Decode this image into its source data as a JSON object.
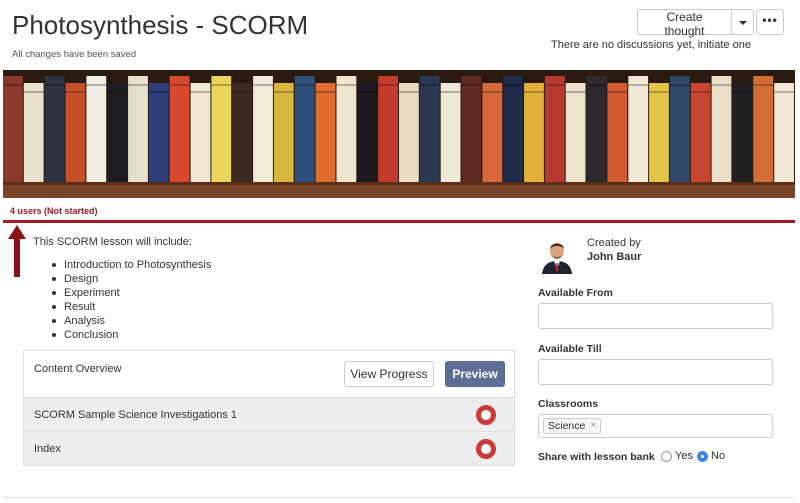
{
  "header": {
    "title": "Photosynthesis - SCORM",
    "save_status": "All changes have been saved",
    "create_thought_label": "Create thought",
    "more_label": "•••",
    "discussion_note": "There are no discussions yet, initiate one"
  },
  "banner": {
    "image": "bookshelf-banner",
    "spines": [
      {
        "color": "#8b3a2a",
        "text": ""
      },
      {
        "color": "#e8e2cf",
        "text": "MIDNIGHT"
      },
      {
        "color": "#2b3440",
        "text": ""
      },
      {
        "color": "#c84f2c",
        "text": ""
      },
      {
        "color": "#f1ede2",
        "text": "THE ELEGANT UNIVERSE"
      },
      {
        "color": "#1f1d24",
        "text": "MOUNTAINS"
      },
      {
        "color": "#e6dfcc",
        "text": ""
      },
      {
        "color": "#2e3e7a",
        "text": "SCIENCE"
      },
      {
        "color": "#d84a2e",
        "text": ""
      },
      {
        "color": "#efe7d1",
        "text": "OLD MAN"
      },
      {
        "color": "#e9d55a",
        "text": ""
      },
      {
        "color": "#3d2b22",
        "text": ""
      },
      {
        "color": "#f2ebda",
        "text": "HOOK BOOKS"
      },
      {
        "color": "#d9b73c",
        "text": "USED"
      },
      {
        "color": "#2d4f7a",
        "text": ""
      },
      {
        "color": "#e26b2f",
        "text": "THE MYSTERY"
      },
      {
        "color": "#efe5cf",
        "text": ""
      },
      {
        "color": "#1d1a1f",
        "text": ""
      },
      {
        "color": "#c43a2b",
        "text": "ENCYCLOPEDIA"
      },
      {
        "color": "#e7dcbf",
        "text": ""
      },
      {
        "color": "#2a3852",
        "text": ""
      },
      {
        "color": "#eee8d6",
        "text": "THE TAROT"
      },
      {
        "color": "#5e2a22",
        "text": ""
      },
      {
        "color": "#d7683a",
        "text": ""
      },
      {
        "color": "#1f2b48",
        "text": "ENGLISH"
      },
      {
        "color": "#e2b13c",
        "text": ""
      },
      {
        "color": "#b63a2f",
        "text": "WORLD OF FANTASY"
      },
      {
        "color": "#ebe3ce",
        "text": ""
      },
      {
        "color": "#2c2a2f",
        "text": ""
      },
      {
        "color": "#d45a30",
        "text": ""
      },
      {
        "color": "#f0e8d5",
        "text": "GIANT"
      },
      {
        "color": "#e2c447",
        "text": ""
      },
      {
        "color": "#304767",
        "text": ""
      },
      {
        "color": "#c94530",
        "text": ""
      },
      {
        "color": "#e9dfc6",
        "text": "JUNGLE"
      },
      {
        "color": "#222024",
        "text": ""
      },
      {
        "color": "#d46d34",
        "text": ""
      },
      {
        "color": "#efe7d3",
        "text": ""
      }
    ]
  },
  "progress": {
    "users_status": "4 users (Not started)"
  },
  "lesson": {
    "intro": "This SCORM lesson will include:",
    "topics": [
      "Introduction to Photosynthesis",
      "Design",
      "Experiment",
      "Result",
      "Analysis",
      "Conclusion"
    ]
  },
  "content_panel": {
    "title": "Content Overview",
    "view_progress_label": "View Progress",
    "preview_label": "Preview",
    "items": [
      {
        "label": "SCORM Sample Science Investigations 1"
      },
      {
        "label": "Index"
      }
    ]
  },
  "creator": {
    "label": "Created by",
    "name": "John Baur"
  },
  "form": {
    "available_from_label": "Available From",
    "available_from_value": "",
    "available_till_label": "Available Till",
    "available_till_value": "",
    "classrooms_label": "Classrooms",
    "classroom_tags": [
      "Science"
    ],
    "tag_remove": "×",
    "share_label": "Share with lesson bank",
    "share_yes": "Yes",
    "share_no": "No",
    "share_selected": "No"
  },
  "colors": {
    "accent_red": "#a11c24",
    "preview_button": "#5e6f97",
    "radio_selected": "#3a86e0",
    "status_ring": "#cc3b3b"
  }
}
